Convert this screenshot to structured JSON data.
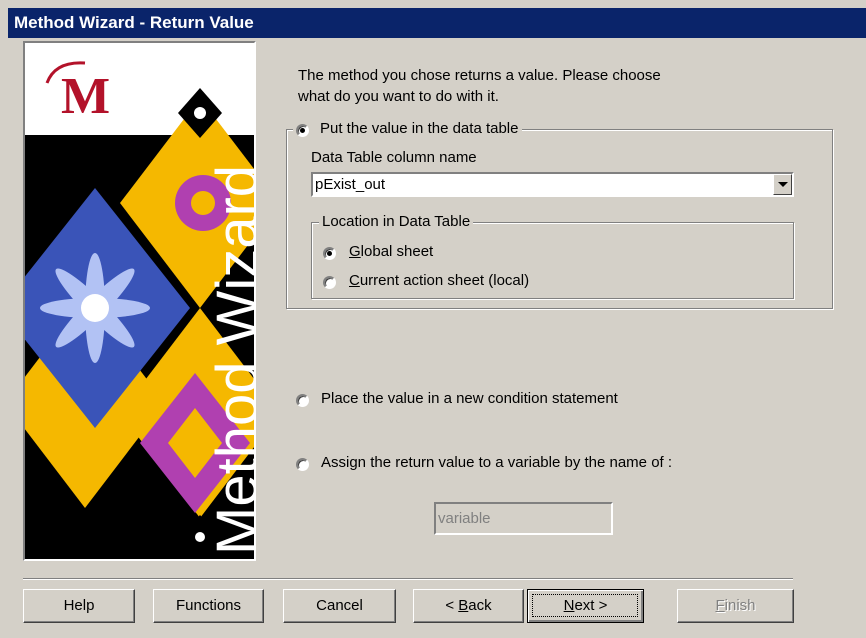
{
  "window": {
    "title": "Method Wizard - Return Value"
  },
  "graphic": {
    "logo_letter": "M",
    "vertical_text": "Method Wizard"
  },
  "intro": {
    "line1": "The method you chose returns a value. Please choose",
    "line2": "what do you want to do with it."
  },
  "options": {
    "put_in_table": {
      "label": "Put the value in the data table",
      "checked": true
    },
    "column_label": "Data Table column name",
    "column_value": "pExist_out",
    "location": {
      "title": "Location in Data Table",
      "global": {
        "label_pre": "",
        "hotkey": "G",
        "label_post": "lobal sheet",
        "checked": true
      },
      "local": {
        "label_pre": "",
        "hotkey": "C",
        "label_post": "urrent action sheet (local)",
        "checked": false
      }
    },
    "condition": {
      "label": "Place the value in a new condition statement",
      "checked": false
    },
    "assign": {
      "label": "Assign the return value to a variable by the name of :",
      "checked": false
    },
    "variable_placeholder": "variable"
  },
  "buttons": {
    "help": "Help",
    "functions": "Functions",
    "cancel": "Cancel",
    "back_pre": "< ",
    "back_hotkey": "B",
    "back_post": "ack",
    "next_hotkey": "N",
    "next_post": "ext >",
    "finish_hotkey": "F",
    "finish_post": "inish"
  },
  "colors": {
    "title_bg": "#0a246a",
    "face": "#d4d0c8",
    "graphic_yellow": "#f5b800",
    "graphic_purple": "#b040b0"
  }
}
